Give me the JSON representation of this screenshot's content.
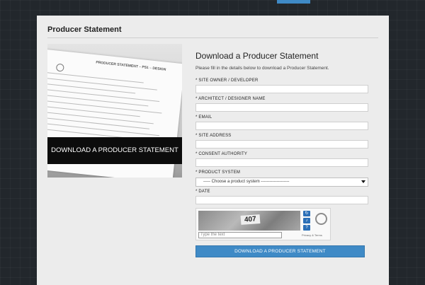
{
  "panel": {
    "title": "Producer Statement"
  },
  "preview": {
    "banner": "DOWNLOAD A PRODUCER STATEMENT",
    "document_heading": "PRODUCER STATEMENT – PS1 – DESIGN"
  },
  "form": {
    "title": "Download a Producer Statement",
    "description": "Please fill in the details below to download a Producer Statement.",
    "fields": [
      {
        "label": "* SITE OWNER / DEVELOPER"
      },
      {
        "label": "* ARCHITECT / DESIGNER NAME"
      },
      {
        "label": "* EMAIL"
      },
      {
        "label": "* SITE ADDRESS"
      },
      {
        "label": "* CONSENT AUTHORITY"
      }
    ],
    "product_system": {
      "label": "* PRODUCT SYSTEM",
      "selected": "----- Choose a product system --------------------"
    },
    "date": {
      "label": "* DATE"
    },
    "captcha": {
      "code": "407",
      "placeholder": "Type the text",
      "links": "Privacy & Terms",
      "refresh_icon": "refresh-icon",
      "audio_icon": "audio-icon",
      "help_icon": "help-icon"
    },
    "submit_label": "DOWNLOAD A PRODUCER STATEMENT"
  },
  "colors": {
    "accent": "#3f8ac6",
    "panel_bg": "#ececec",
    "page_bg": "#22272c"
  }
}
